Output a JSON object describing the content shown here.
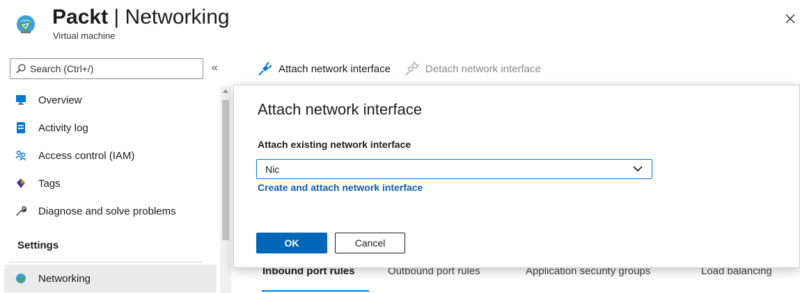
{
  "header": {
    "title_strong": "Packt",
    "title_rest": " | Networking",
    "subtitle": "Virtual machine",
    "icons": {
      "resource": "virtual-machine-icon",
      "close": "close-icon"
    }
  },
  "sidebar": {
    "search": {
      "placeholder": "Search (Ctrl+/)",
      "icon": "search-icon"
    },
    "collapse_label": "«",
    "items": [
      {
        "label": "Overview",
        "icon": "monitor-icon"
      },
      {
        "label": "Activity log",
        "icon": "log-icon"
      },
      {
        "label": "Access control (IAM)",
        "icon": "people-icon"
      },
      {
        "label": "Tags",
        "icon": "tag-icon"
      },
      {
        "label": "Diagnose and solve problems",
        "icon": "wrench-icon"
      }
    ],
    "settings_heading": "Settings",
    "settings_items": [
      {
        "label": "Networking",
        "icon": "network-icon",
        "selected": true
      }
    ]
  },
  "toolbar": {
    "attach_label": "Attach network interface",
    "detach_label": "Detach network interface",
    "icons": {
      "attach": "plug-icon",
      "detach": "unplug-icon"
    }
  },
  "tabs": [
    {
      "label": "Inbound port rules",
      "active": true
    },
    {
      "label": "Outbound port rules",
      "active": false
    },
    {
      "label": "Application security groups",
      "active": false
    },
    {
      "label": "Load balancing",
      "active": false
    }
  ],
  "dialog": {
    "title": "Attach network interface",
    "field_label": "Attach existing network interface",
    "select_value": "Nic",
    "create_link": "Create and attach network interface",
    "ok_label": "OK",
    "cancel_label": "Cancel"
  },
  "colors": {
    "accent": "#0078d4",
    "primary_button": "#0067b8",
    "link": "#0f5cab",
    "selected_bg": "#ebebeb"
  }
}
